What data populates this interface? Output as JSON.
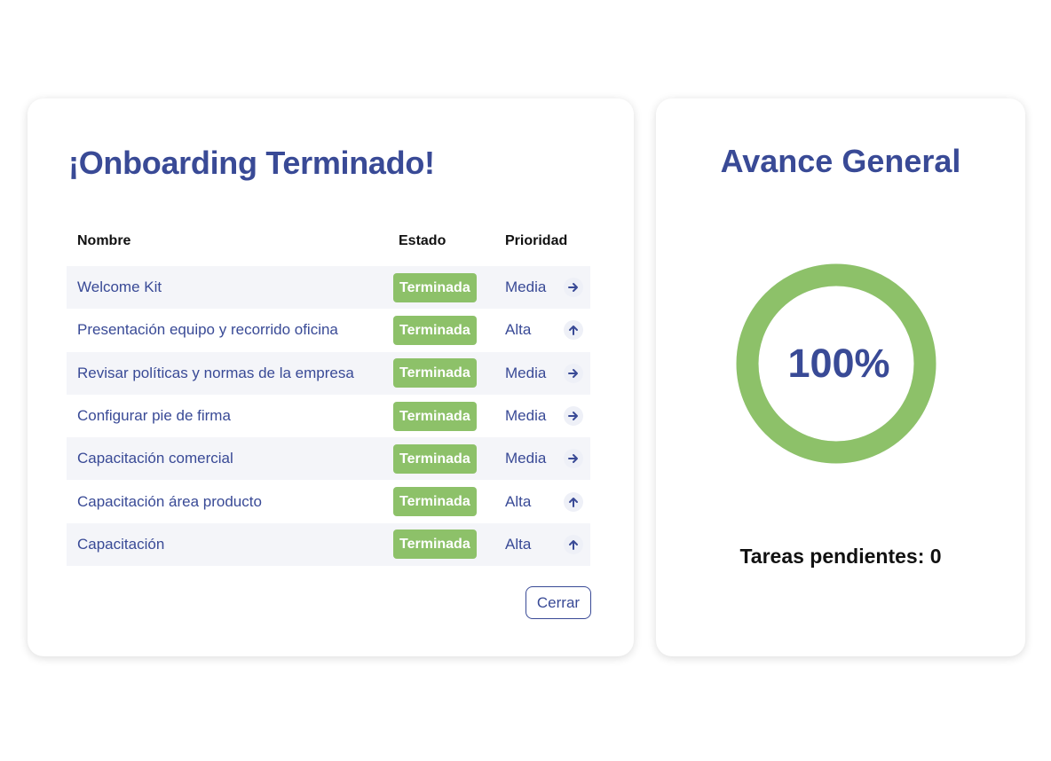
{
  "tasks_card": {
    "title": "¡Onboarding Terminado!",
    "columns": {
      "name": "Nombre",
      "status": "Estado",
      "priority": "Prioridad"
    },
    "rows": [
      {
        "name": "Welcome Kit",
        "status": "Terminada",
        "priority": "Media",
        "priority_icon": "arrow-right-icon"
      },
      {
        "name": "Presentación equipo y recorrido oficina",
        "status": "Terminada",
        "priority": "Alta",
        "priority_icon": "arrow-up-icon"
      },
      {
        "name": "Revisar políticas y normas de la empresa",
        "status": "Terminada",
        "priority": "Media",
        "priority_icon": "arrow-right-icon"
      },
      {
        "name": "Configurar pie de firma",
        "status": "Terminada",
        "priority": "Media",
        "priority_icon": "arrow-right-icon"
      },
      {
        "name": "Capacitación comercial",
        "status": "Terminada",
        "priority": "Media",
        "priority_icon": "arrow-right-icon"
      },
      {
        "name": "Capacitación área producto",
        "status": "Terminada",
        "priority": "Alta",
        "priority_icon": "arrow-up-icon"
      },
      {
        "name": "Capacitación",
        "status": "Terminada",
        "priority": "Alta",
        "priority_icon": "arrow-up-icon"
      }
    ],
    "close_label": "Cerrar"
  },
  "progress_card": {
    "title": "Avance General",
    "percent_label": "100%",
    "percent_value": 100,
    "pending_label": "Tareas pendientes: 0"
  },
  "colors": {
    "primary": "#394a96",
    "success": "#8dc169",
    "row_shade": "#f4f5f9",
    "text_dark": "#111111"
  }
}
